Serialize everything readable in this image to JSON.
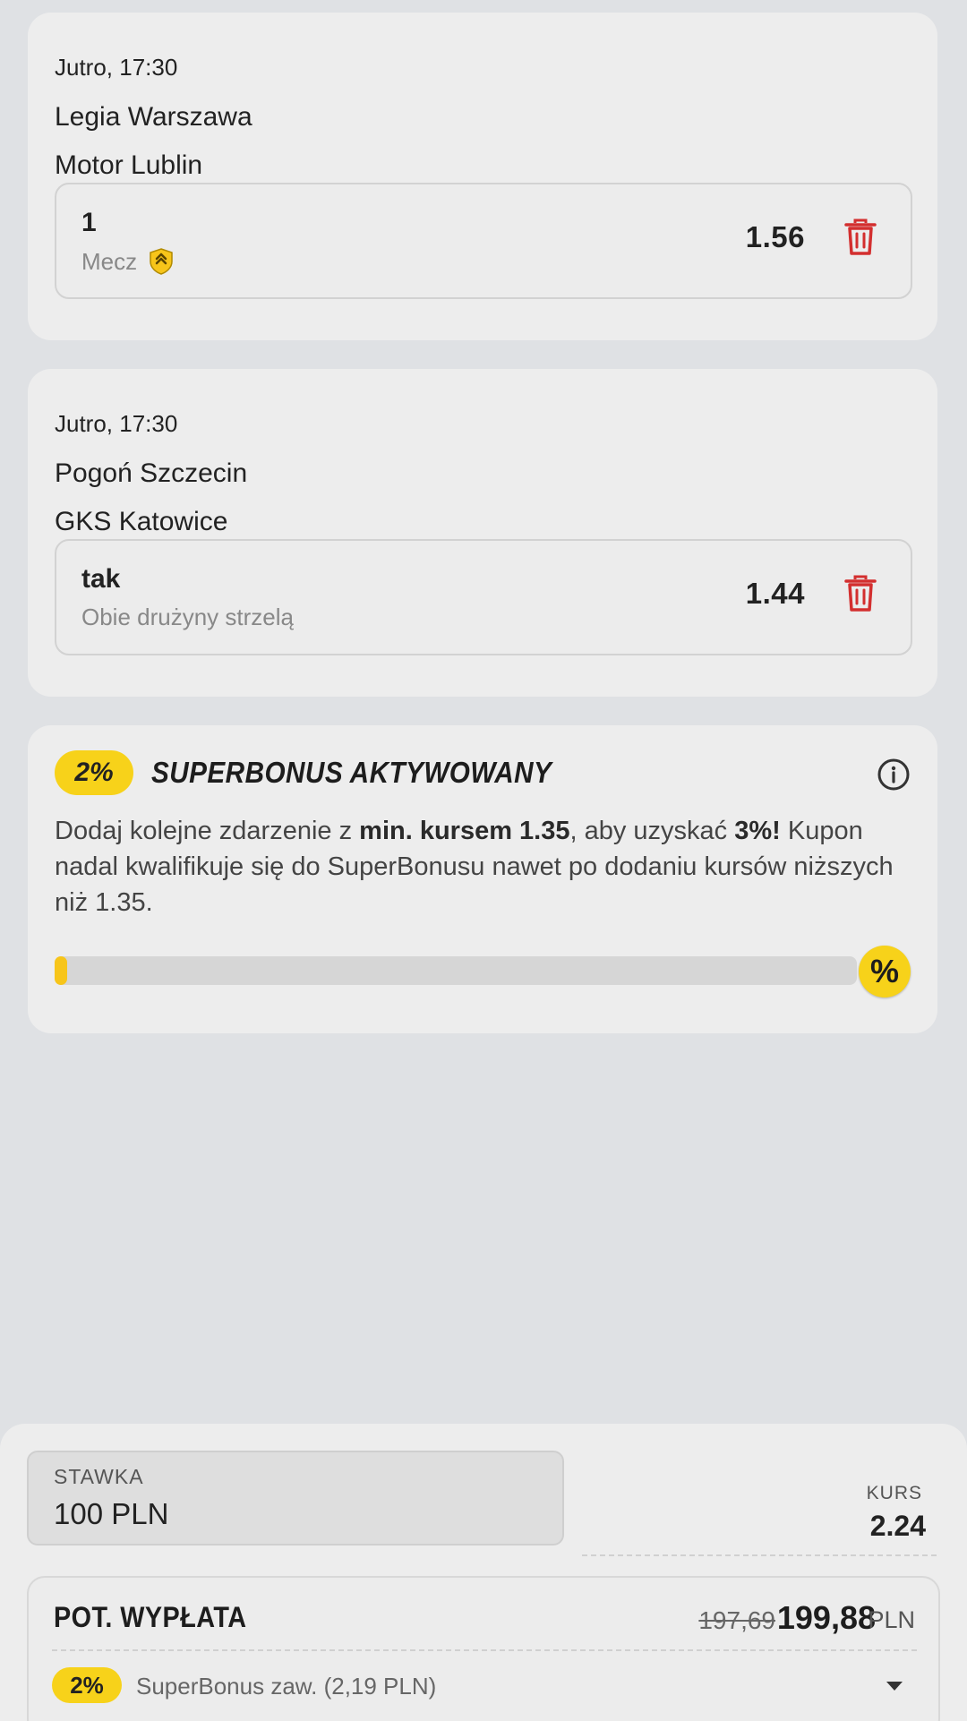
{
  "bets": [
    {
      "date": "Jutro, 17:30",
      "team_home": "Legia Warszawa",
      "team_away": "Motor Lublin",
      "pick": "1",
      "market": "Mecz",
      "market_badge": "shield-boost-icon",
      "odds": "1.56"
    },
    {
      "date": "Jutro, 17:30",
      "team_home": "Pogoń Szczecin",
      "team_away": "GKS Katowice",
      "pick": "tak",
      "market": "Obie drużyny strzelą",
      "odds": "1.44"
    }
  ],
  "superbonus": {
    "pill": "2%",
    "title": "SUPERBONUS AKTYWOWANY",
    "text_1": "Dodaj kolejne zdarzenie z ",
    "text_b1": "min. kursem 1.35",
    "text_2": ", aby uzyskać ",
    "text_b2": "3%!",
    "text_3": " Kupon nadal kwalifikuje się do SuperBonusu nawet po dodaniu kursów niższych niż 1.35.",
    "progress_fraction": 0.015,
    "percent_glyph": "%"
  },
  "footer": {
    "stake_label": "STAWKA",
    "stake_value": "100 PLN",
    "kurs_label": "KURS",
    "kurs_value": "2.24",
    "payout_title": "POT. WYPŁATA",
    "payout_old": "197,69",
    "payout_new": "199,88",
    "payout_currency": "PLN",
    "bonus_pill": "2%",
    "bonus_text": "SuperBonus zaw. (2,19 PLN)"
  },
  "colors": {
    "accent_yellow": "#f7d21a",
    "trash_red": "#d32f2f",
    "background": "#dfe1e4",
    "card": "#ededed"
  }
}
